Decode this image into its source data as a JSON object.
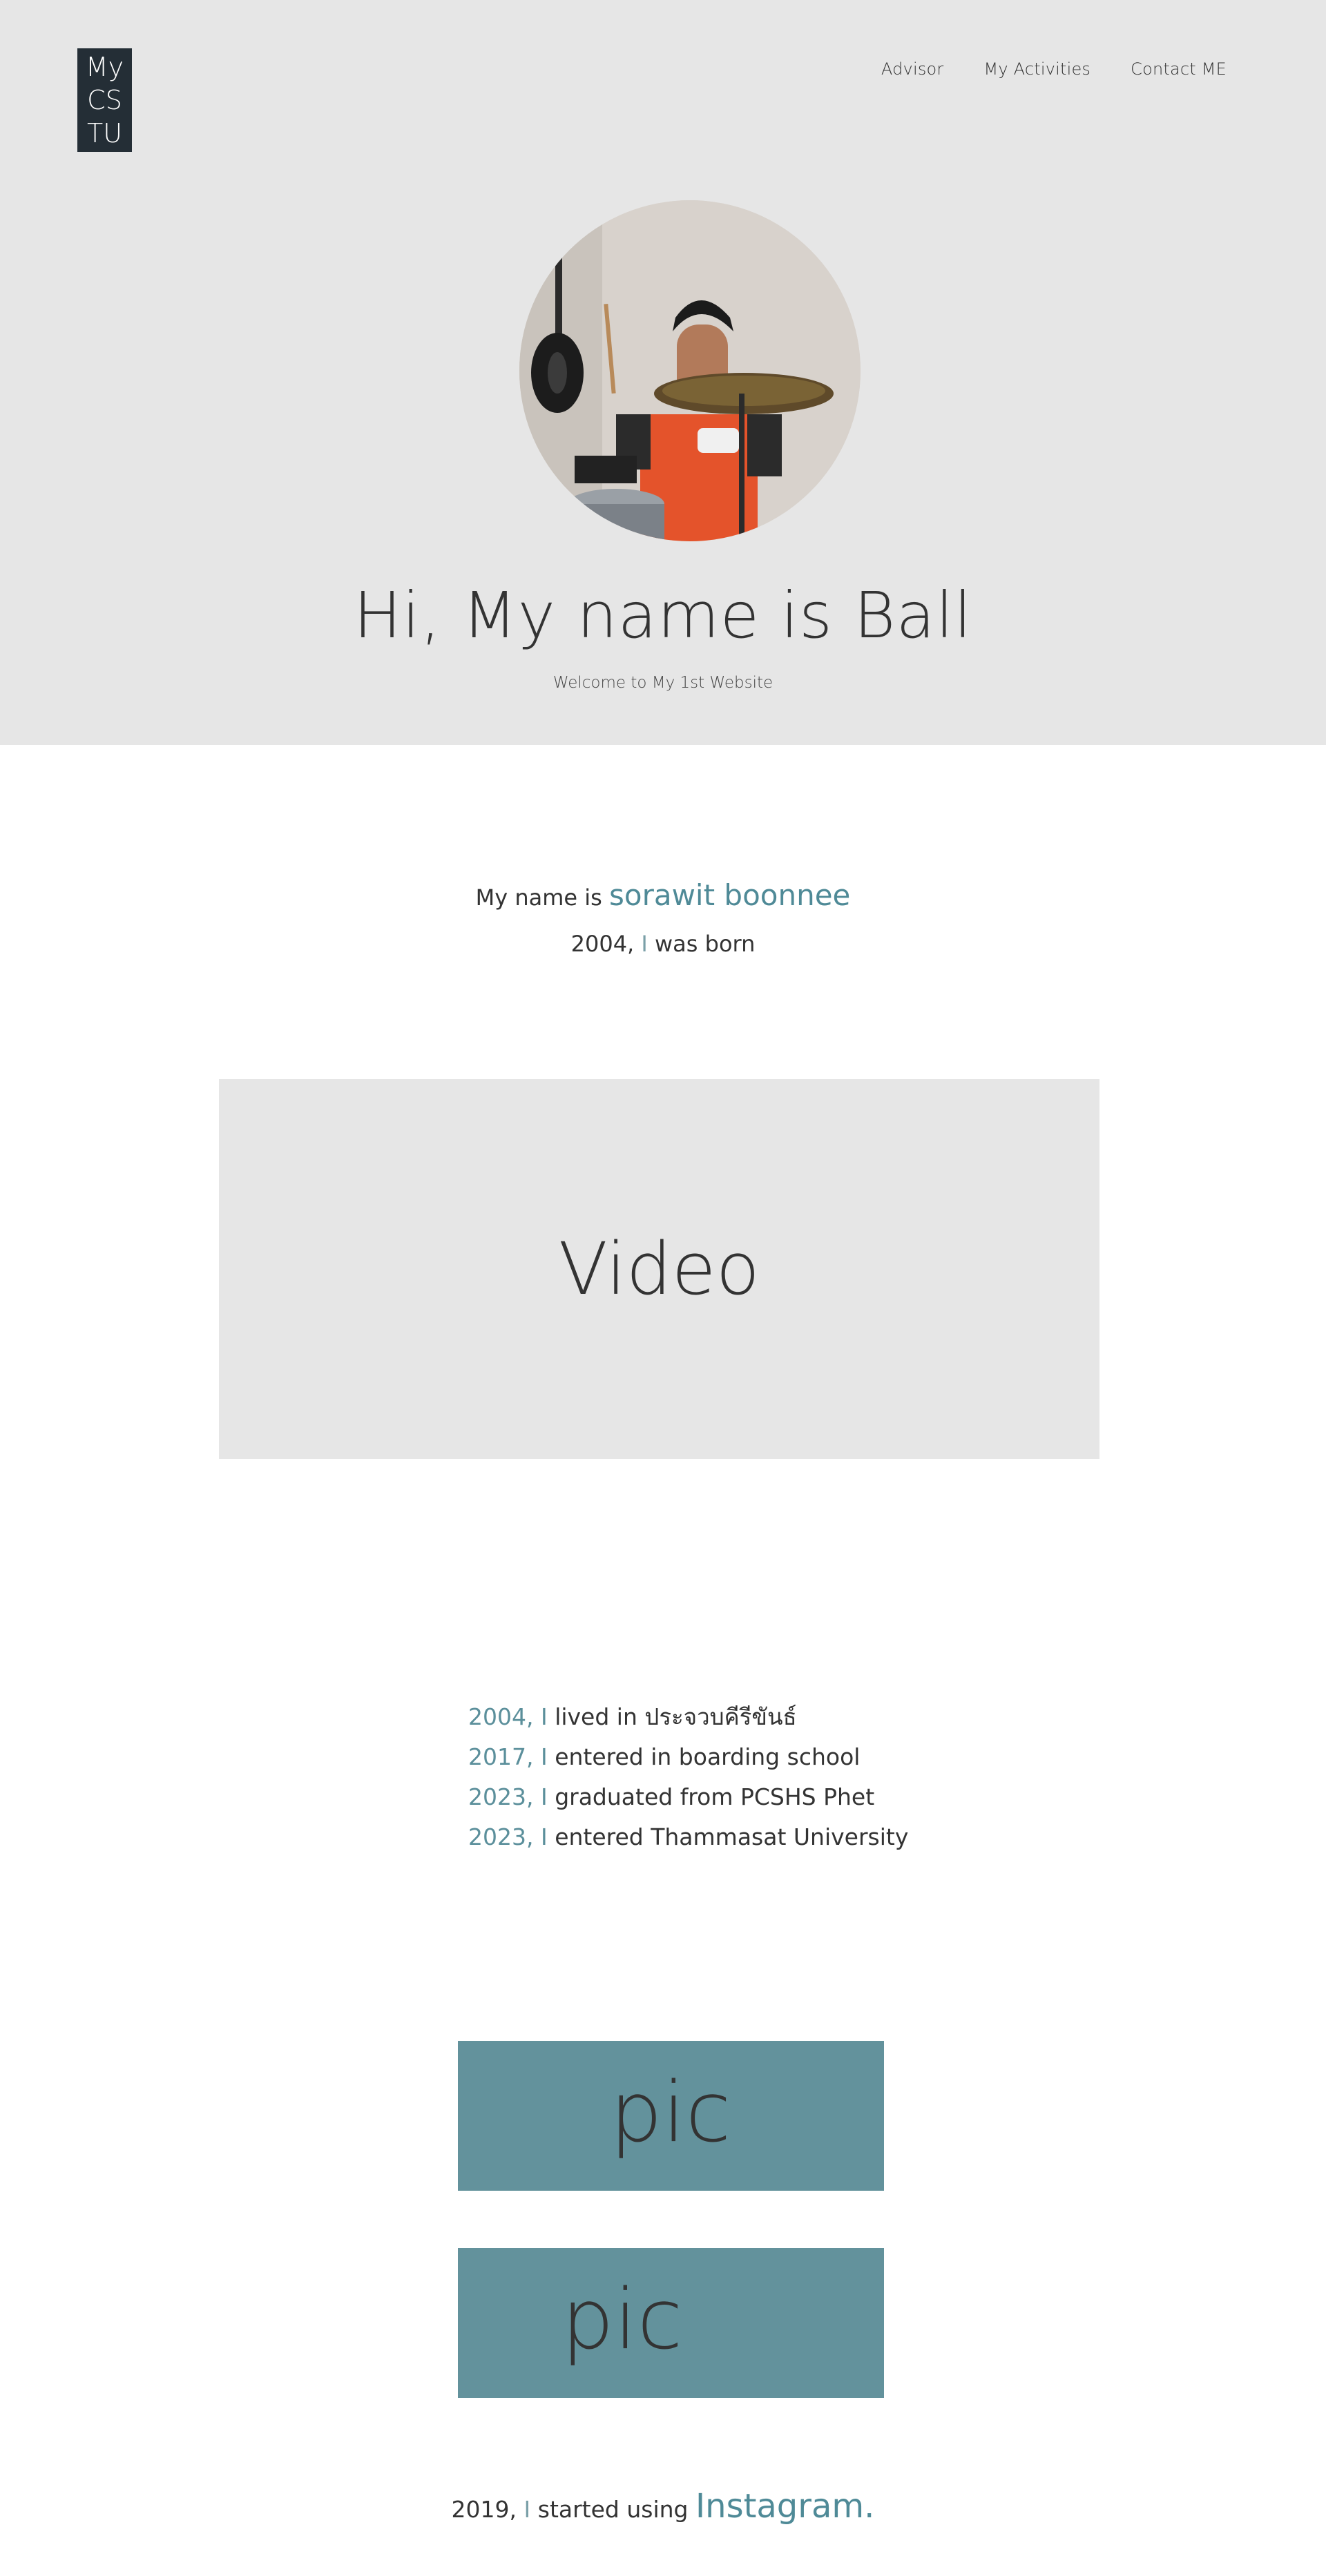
{
  "header": {
    "logo_lines": [
      "My",
      "CS",
      "TU"
    ],
    "nav": [
      "Advisor",
      "My Activities",
      "Contact ME"
    ]
  },
  "hero": {
    "title": "Hi, My name is Ball",
    "subtitle": "Welcome to My 1st Website"
  },
  "intro": {
    "prefix": "My name is ",
    "name": "sorawit boonnee",
    "born_year": "2004,",
    "born_i": " I ",
    "born_text": "was born"
  },
  "video": {
    "label": "Video"
  },
  "timeline": [
    {
      "year": "2004, I",
      "text": " lived in ประจวบคีรีขันธ์"
    },
    {
      "year": "2017, I",
      "text": " entered in boarding school"
    },
    {
      "year": "2023, I",
      "text": " graduated from PCSHS Phet"
    },
    {
      "year": "2023, I",
      "text": " entered Thammasat University"
    }
  ],
  "pics": [
    "pic",
    "pic"
  ],
  "instagram": {
    "year": "2019,",
    "i": " I ",
    "text": "started using ",
    "link": "Instagram."
  },
  "colors": {
    "hero_bg": "#e6e6e6",
    "logo_bg": "#242e36",
    "accent": "#4f8a97",
    "pic_bg": "#63929c"
  }
}
